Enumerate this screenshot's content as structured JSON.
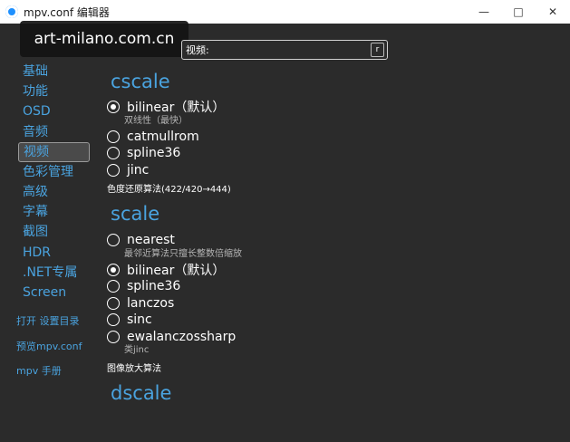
{
  "window": {
    "title": "mpv.conf 编辑器",
    "controls": {
      "minimize": "—",
      "maximize": "□",
      "close": "✕"
    }
  },
  "watermark": "art-milano.com.cn",
  "search": {
    "placeholder": "视频:",
    "button": "r"
  },
  "sidebar": {
    "items": [
      "基础",
      "功能",
      "OSD",
      "音频",
      "视频",
      "色彩管理",
      "高级",
      "字幕",
      "截图",
      "HDR",
      ".NET专属",
      "Screen"
    ],
    "active": "视频",
    "links": [
      "打开 设置目录",
      "预览mpv.conf",
      "mpv 手册"
    ]
  },
  "sections": {
    "cscale": {
      "title": "cscale",
      "options": [
        {
          "label": "bilinear（默认）",
          "checked": true,
          "desc": "双线性（最快）"
        },
        {
          "label": "catmullrom",
          "checked": false
        },
        {
          "label": "spline36",
          "checked": false
        },
        {
          "label": "jinc",
          "checked": false
        }
      ],
      "note": "色度还原算法(422/420→444)"
    },
    "scale": {
      "title": "scale",
      "options": [
        {
          "label": "nearest",
          "checked": false,
          "desc": "最邻近算法只擅长整数倍缩放"
        },
        {
          "label": "bilinear（默认）",
          "checked": true
        },
        {
          "label": "spline36",
          "checked": false
        },
        {
          "label": "lanczos",
          "checked": false
        },
        {
          "label": "sinc",
          "checked": false
        },
        {
          "label": "ewalanczossharp",
          "checked": false,
          "desc": "类jinc"
        }
      ],
      "note": "图像放大算法"
    },
    "dscale": {
      "title": "dscale"
    }
  },
  "colors": {
    "accent": "#4aa3df",
    "background": "#2b2b2b",
    "titlebar": "#ffffff",
    "active_nav_bg": "#4a4a4a"
  }
}
